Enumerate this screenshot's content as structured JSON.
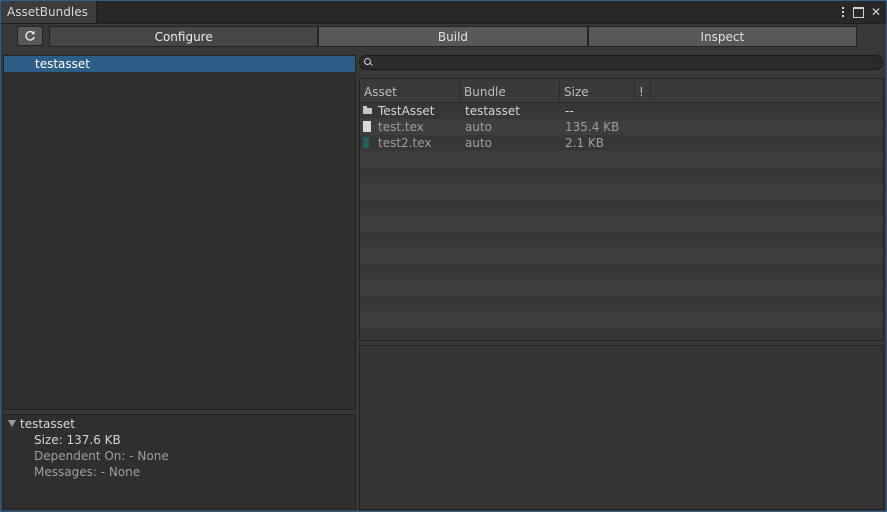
{
  "window": {
    "tab_title": "AssetBundles",
    "icons": [
      "more-options-icon",
      "maximize-icon",
      "close-icon"
    ],
    "accent": "#2c5d87"
  },
  "toolbar": {
    "refresh_icon": "refresh-icon",
    "modes": [
      {
        "label": "Configure",
        "active": true
      },
      {
        "label": "Build",
        "active": false
      },
      {
        "label": "Inspect",
        "active": false
      }
    ]
  },
  "bundle_tree": {
    "items": [
      {
        "label": "testasset",
        "selected": true
      }
    ]
  },
  "bundle_detail": {
    "title": "testasset",
    "size": "Size: 137.6 KB",
    "dependent_on": "Dependent On: - None",
    "messages": "Messages: - None"
  },
  "asset_list": {
    "search_placeholder": "",
    "columns": [
      "Asset",
      "Bundle",
      "Size",
      "!"
    ],
    "rows": [
      {
        "icon": "folder-icon",
        "asset": "TestAsset",
        "bundle": "testasset",
        "size": "--"
      },
      {
        "icon": "texture-file-icon",
        "asset": "test.tex",
        "bundle": "auto",
        "size": "135.4 KB"
      },
      {
        "icon": "texture-file-icon",
        "asset": "test2.tex",
        "bundle": "auto",
        "size": "2.1 KB"
      }
    ]
  }
}
